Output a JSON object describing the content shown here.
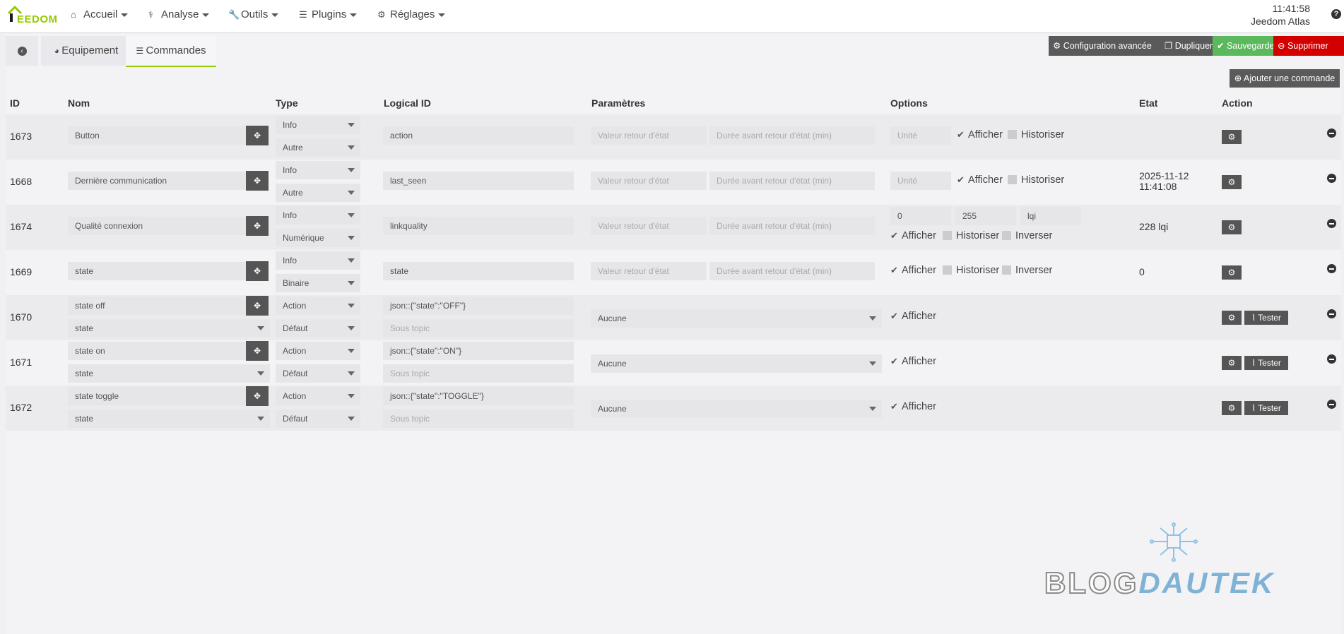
{
  "app": {
    "logo_text_first": "J",
    "logo_text_rest": "EEDOM",
    "time": "11:41:58",
    "host": "Jeedom Atlas"
  },
  "nav": [
    {
      "label": "Accueil",
      "icon": "home-icon",
      "glyph": "⌂"
    },
    {
      "label": "Analyse",
      "icon": "stethoscope-icon",
      "glyph": "⚕"
    },
    {
      "label": "Outils",
      "icon": "wrench-icon",
      "glyph": "🔧"
    },
    {
      "label": "Plugins",
      "icon": "list-icon",
      "glyph": "☰"
    },
    {
      "label": "Réglages",
      "icon": "gear-icon",
      "glyph": "⚙"
    }
  ],
  "tabs": {
    "equipement": "Equipement",
    "commandes": "Commandes"
  },
  "actions": {
    "config": "Configuration avancée",
    "dupliquer": "Dupliquer",
    "sauvegarder": "Sauvegarder",
    "supprimer": "Supprimer",
    "ajouter": "Ajouter une commande"
  },
  "headers": {
    "id": "ID",
    "nom": "Nom",
    "type": "Type",
    "logical": "Logical ID",
    "params": "Paramètres",
    "options": "Options",
    "etat": "Etat",
    "action": "Action"
  },
  "placeholders": {
    "valeur_retour": "Valeur retour d'état",
    "duree_retour": "Durée avant retour d'état (min)",
    "unite": "Unité",
    "sous_topic": "Sous topic"
  },
  "labels": {
    "afficher": "Afficher",
    "historiser": "Historiser",
    "inverser": "Inverser",
    "tester": "Tester",
    "aucune": "Aucune"
  },
  "rows": [
    {
      "id": "1673",
      "name": "Button",
      "type": "Info",
      "subtype": "Autre",
      "logical": "action",
      "etat": ""
    },
    {
      "id": "1668",
      "name": "Dernière communication",
      "type": "Info",
      "subtype": "Autre",
      "logical": "last_seen",
      "etat": "2025-11-12",
      "etat2": "11:41:08"
    },
    {
      "id": "1674",
      "name": "Qualité connexion",
      "type": "Info",
      "subtype": "Numérique",
      "logical": "linkquality",
      "etat": "228 lqi",
      "min": "0",
      "max": "255",
      "unit": "lqi"
    },
    {
      "id": "1669",
      "name": "state",
      "type": "Info",
      "subtype": "Binaire",
      "logical": "state",
      "etat": "0"
    },
    {
      "id": "1670",
      "name": "state off",
      "value": "state",
      "type": "Action",
      "subtype": "Défaut",
      "logical": "json::{\"state\":\"OFF\"}"
    },
    {
      "id": "1671",
      "name": "state on",
      "value": "state",
      "type": "Action",
      "subtype": "Défaut",
      "logical": "json::{\"state\":\"ON\"}"
    },
    {
      "id": "1672",
      "name": "state toggle",
      "value": "state",
      "type": "Action",
      "subtype": "Défaut",
      "logical": "json::{\"state\":\"TOGGLE\"}"
    }
  ],
  "watermark": {
    "part1": "BLOG",
    "part2": "DAUTEK"
  }
}
